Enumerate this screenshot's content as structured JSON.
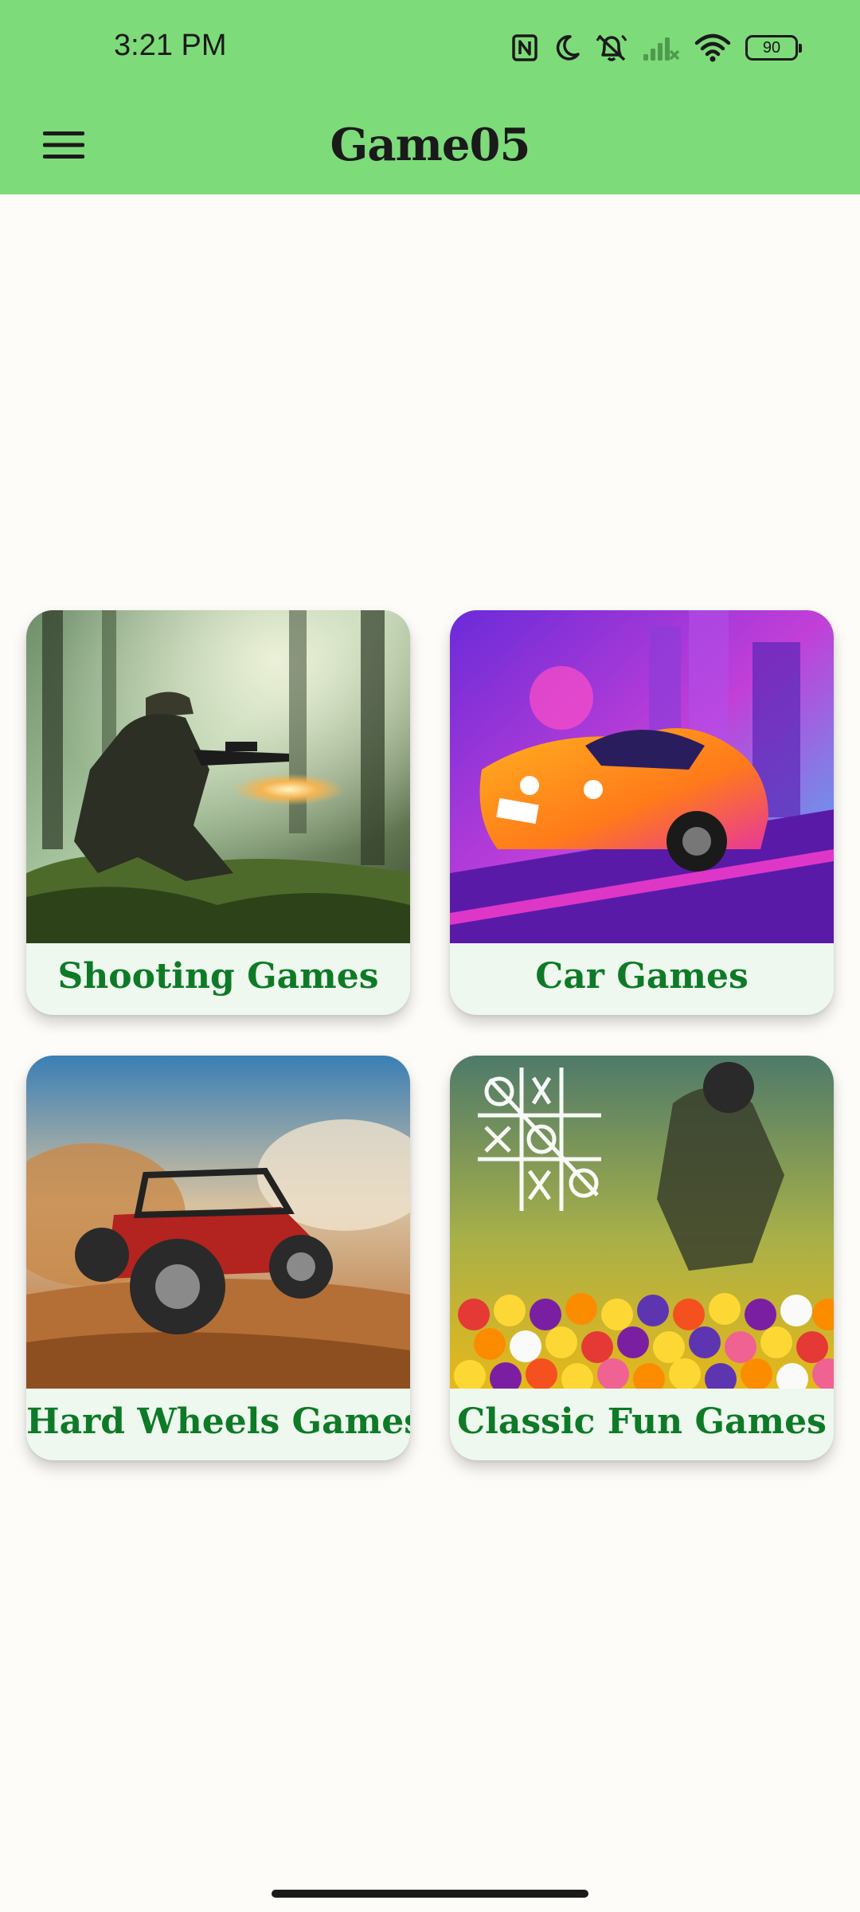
{
  "status_bar": {
    "time": "3:21 PM",
    "battery_level": "90",
    "icons": [
      "nfc-icon",
      "moon-icon",
      "bell-off-icon",
      "signal-off-icon",
      "wifi-icon",
      "battery-icon"
    ]
  },
  "app_bar": {
    "title": "Game05",
    "menu_icon": "hamburger-menu-icon",
    "background_color": "#7edb7a"
  },
  "categories": [
    {
      "label": "Shooting Games",
      "image": "soldier in forest"
    },
    {
      "label": "Car Games",
      "image": "orange sports car in neon city"
    },
    {
      "label": "Hard Wheels Games",
      "image": "red buggy in desert dust"
    },
    {
      "label": "Classic Fun Games",
      "image": "tic-tac-toe, motocross rider and candies"
    }
  ],
  "colors": {
    "label_text": "#0e7a27",
    "card_label_bg": "#eef8ee",
    "page_background": "#fdfcf8"
  }
}
